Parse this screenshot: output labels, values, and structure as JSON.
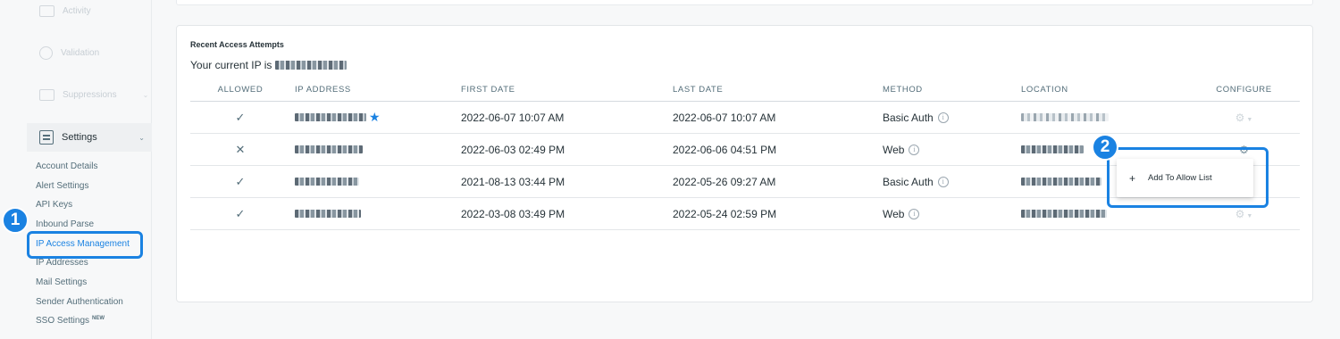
{
  "sidebar": {
    "faded_items": [
      {
        "label": "Activity",
        "icon": "mail-icon"
      },
      {
        "label": "Validation",
        "icon": "validation-icon"
      },
      {
        "label": "Suppressions",
        "icon": "suppressions-icon"
      }
    ],
    "settings": {
      "label": "Settings",
      "icon": "settings-icon"
    },
    "sub_items": [
      "Account Details",
      "Alert Settings",
      "API Keys",
      "Inbound Parse",
      "IP Access Management",
      "IP Addresses",
      "Mail Settings",
      "Sender Authentication",
      "SSO Settings"
    ],
    "active_item": "IP Access Management",
    "new_badge": "NEW"
  },
  "steps": {
    "one": "1",
    "two": "2"
  },
  "card": {
    "title": "Recent Access Attempts",
    "current_ip_label": "Your current IP is"
  },
  "table": {
    "headers": [
      "ALLOWED",
      "IP ADDRESS",
      "FIRST DATE",
      "LAST DATE",
      "METHOD",
      "LOCATION",
      "CONFIGURE"
    ],
    "rows": [
      {
        "allowed": "✓",
        "first_date": "2022-06-07 10:07 AM",
        "last_date": "2022-06-07 10:07 AM",
        "method": "Basic Auth"
      },
      {
        "allowed": "✕",
        "first_date": "2022-06-03 02:49 PM",
        "last_date": "2022-06-06 04:51 PM",
        "method": "Web"
      },
      {
        "allowed": "✓",
        "first_date": "2021-08-13 03:44 PM",
        "last_date": "2022-05-26 09:27 AM",
        "method": "Basic Auth"
      },
      {
        "allowed": "✓",
        "first_date": "2022-03-08 03:49 PM",
        "last_date": "2022-05-24 02:59 PM",
        "method": "Web"
      }
    ]
  },
  "popover": {
    "item_label": "Add To Allow List",
    "plus": "+"
  },
  "colors": {
    "accent": "#1a82e2"
  }
}
